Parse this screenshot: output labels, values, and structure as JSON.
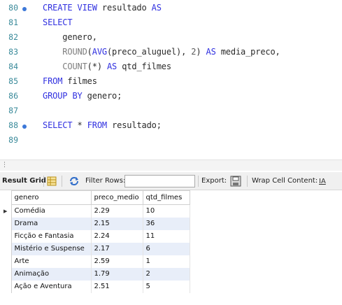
{
  "editor": {
    "lines": [
      {
        "no": "80",
        "marker": true,
        "segments": [
          [
            "kw",
            "CREATE VIEW "
          ],
          [
            "tx",
            "resultado "
          ],
          [
            "kw",
            "AS"
          ]
        ]
      },
      {
        "no": "81",
        "marker": false,
        "segments": [
          [
            "kw",
            "SELECT"
          ]
        ]
      },
      {
        "no": "82",
        "marker": false,
        "segments": [
          [
            "tx",
            "    genero,"
          ]
        ]
      },
      {
        "no": "83",
        "marker": false,
        "segments": [
          [
            "fn",
            "    ROUND"
          ],
          [
            "tx",
            "("
          ],
          [
            "kw",
            "AVG"
          ],
          [
            "tx",
            "(preco_aluguel), "
          ],
          [
            "num",
            "2"
          ],
          [
            "tx",
            ") "
          ],
          [
            "kw",
            "AS"
          ],
          [
            "tx",
            " media_preco,"
          ]
        ]
      },
      {
        "no": "84",
        "marker": false,
        "segments": [
          [
            "fn",
            "    COUNT"
          ],
          [
            "tx",
            "(*) "
          ],
          [
            "kw",
            "AS"
          ],
          [
            "tx",
            " qtd_filmes"
          ]
        ]
      },
      {
        "no": "85",
        "marker": false,
        "segments": [
          [
            "kw",
            "FROM"
          ],
          [
            "tx",
            " filmes"
          ]
        ]
      },
      {
        "no": "86",
        "marker": false,
        "segments": [
          [
            "kw",
            "GROUP BY"
          ],
          [
            "tx",
            " genero;"
          ]
        ]
      },
      {
        "no": "87",
        "marker": false,
        "segments": []
      },
      {
        "no": "88",
        "marker": true,
        "segments": [
          [
            "kw",
            "SELECT"
          ],
          [
            "tx",
            " * "
          ],
          [
            "kw",
            "FROM"
          ],
          [
            "tx",
            " resultado;"
          ]
        ]
      },
      {
        "no": "89",
        "marker": false,
        "segments": []
      }
    ]
  },
  "toolbar": {
    "result_grid_label": "Result Grid",
    "filter_rows_label": "Filter Rows:",
    "filter_value": "",
    "export_label": "Export:",
    "wrap_label": "Wrap Cell Content:"
  },
  "grid": {
    "columns": [
      "genero",
      "preco_medio",
      "qtd_filmes"
    ],
    "rows": [
      [
        "Comédia",
        "2.29",
        "10"
      ],
      [
        "Drama",
        "2.15",
        "36"
      ],
      [
        "Ficção e Fantasia",
        "2.24",
        "11"
      ],
      [
        "Mistério e Suspense",
        "2.17",
        "6"
      ],
      [
        "Arte",
        "2.59",
        "1"
      ],
      [
        "Animação",
        "1.79",
        "2"
      ],
      [
        "Ação e Aventura",
        "2.51",
        "5"
      ]
    ],
    "selected_row_indicator": "▶"
  },
  "colors": {
    "keyword": "#3030e0",
    "function": "#7e7e7e",
    "line_number": "#3a8a9a",
    "marker": "#3c78d8",
    "alt_row": "#e8eef9"
  }
}
